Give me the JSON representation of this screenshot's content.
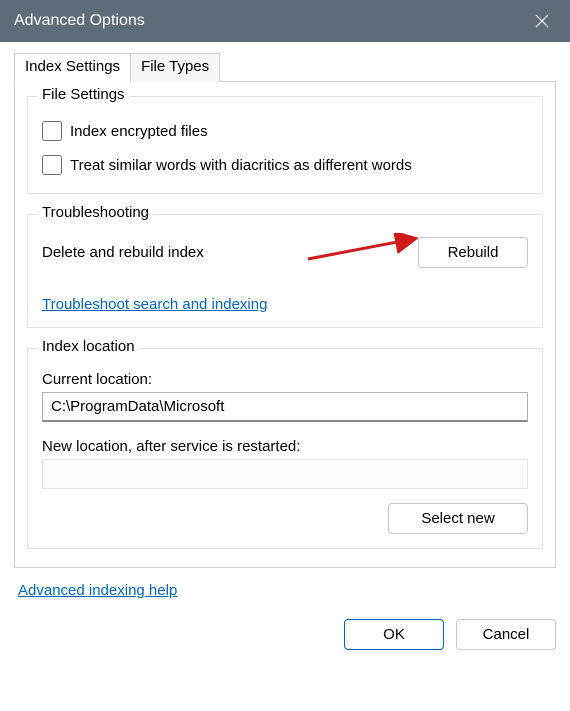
{
  "window": {
    "title": "Advanced Options"
  },
  "tabs": {
    "index_settings": "Index Settings",
    "file_types": "File Types"
  },
  "file_settings": {
    "legend": "File Settings",
    "encrypted": "Index encrypted files",
    "diacritics": "Treat similar words with diacritics as different words"
  },
  "troubleshooting": {
    "legend": "Troubleshooting",
    "delete_rebuild": "Delete and rebuild index",
    "rebuild_button": "Rebuild",
    "troubleshoot_link": "Troubleshoot search and indexing"
  },
  "index_location": {
    "legend": "Index location",
    "current_label": "Current location:",
    "current_value": "C:\\ProgramData\\Microsoft",
    "new_label": "New location, after service is restarted:",
    "new_value": "",
    "select_new": "Select new"
  },
  "footer": {
    "help_link": "Advanced indexing help",
    "ok": "OK",
    "cancel": "Cancel"
  },
  "annotation": {
    "arrow_color": "#d11a1a"
  }
}
